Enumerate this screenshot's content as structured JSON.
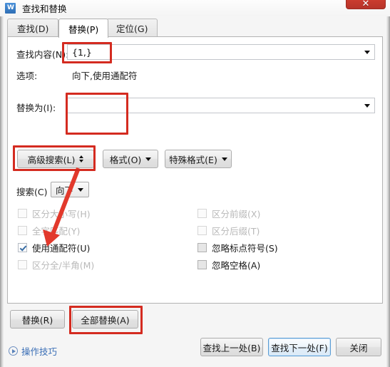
{
  "window": {
    "title": "查找和替换",
    "app_icon": "wps-writer-w-icon",
    "close_label": "✕",
    "accent_red": "#c93b2e",
    "annotation_color": "#d42b20",
    "link_color": "#3b6fb6"
  },
  "tabs": [
    {
      "label": "查找(D)",
      "active": false
    },
    {
      "label": "替换(P)",
      "active": true
    },
    {
      "label": "定位(G)",
      "active": false
    }
  ],
  "find": {
    "label": "查找内容(N):",
    "value": "{1,}",
    "placeholder": ""
  },
  "options": {
    "label": "选项:",
    "value": "向下,使用通配符"
  },
  "replace": {
    "label": "替换为(I):",
    "value": "",
    "placeholder": ""
  },
  "toolbuttons": {
    "advanced_search": "高级搜索(L)",
    "format": "格式(O)",
    "special_format": "特殊格式(E)"
  },
  "search_direction": {
    "label": "搜索(C)",
    "value": "向下"
  },
  "checkboxes_left": [
    {
      "label": "区分大小写(H)",
      "checked": false,
      "disabled": true
    },
    {
      "label": "全字匹配(Y)",
      "checked": false,
      "disabled": true
    },
    {
      "label": "使用通配符(U)",
      "checked": true,
      "disabled": false
    },
    {
      "label": "区分全/半角(M)",
      "checked": false,
      "disabled": true
    }
  ],
  "checkboxes_right": [
    {
      "label": "区分前缀(X)",
      "checked": false,
      "disabled": true
    },
    {
      "label": "区分后缀(T)",
      "checked": false,
      "disabled": true
    },
    {
      "label": "忽略标点符号(S)",
      "checked": false,
      "disabled": false
    },
    {
      "label": "忽略空格(A)",
      "checked": false,
      "disabled": false
    }
  ],
  "action_buttons": {
    "replace": "替换(R)",
    "replace_all": "全部替换(A)"
  },
  "footer": {
    "tips": "操作技巧",
    "find_prev": "查找上一处(B)",
    "find_next": "查找下一处(F)",
    "close": "关闭"
  }
}
